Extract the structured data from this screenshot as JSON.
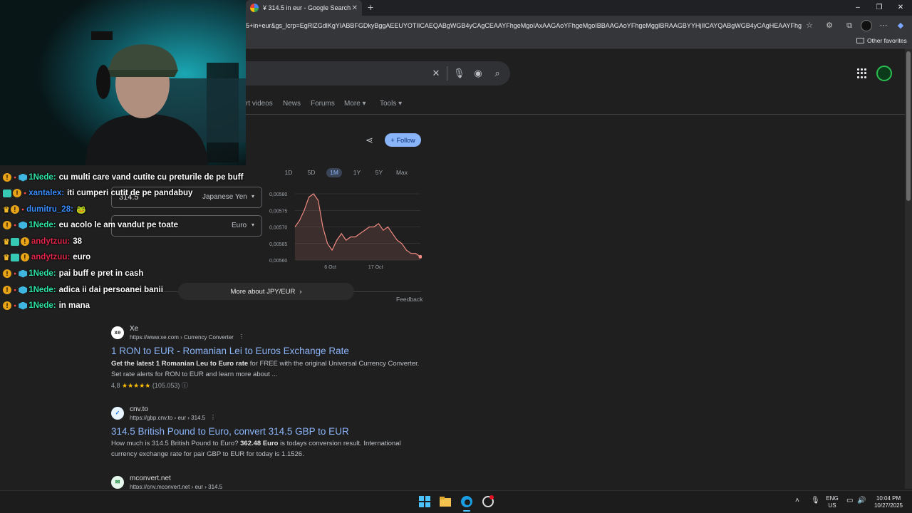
{
  "browser": {
    "tab_title": "¥ 314.5 in eur - Google Search",
    "new_tab": "+",
    "url": "5+in+eur&gs_lcrp=EgRlZGdlKgYIABBFGDkyBggAEEUYOTIICAEQABgWGB4yCAgCEAAYFhgeMgoIAxAAGAoYFhgeMgoIBBAAGAoYFhgeMggIBRAAGBYYHjIICAYQABgWGB4yCAgHEAAYFhge...",
    "other_favorites": "Other favorites",
    "window_controls": {
      "minimize": "–",
      "maximize": "❐",
      "close": "✕"
    }
  },
  "search": {
    "nav_tabs": [
      "rt videos",
      "News",
      "Forums",
      "More ▾",
      "Tools ▾"
    ],
    "follow_label": "Follow"
  },
  "finance": {
    "ranges": [
      "1D",
      "5D",
      "1M",
      "1Y",
      "5Y",
      "Max"
    ],
    "active_range": "1M",
    "converter": {
      "from_value": "314.5",
      "from_currency": "Japanese Yen",
      "to_value": "",
      "to_currency": "Euro"
    },
    "more_about": "More about JPY/EUR",
    "feedback": "Feedback"
  },
  "chart_data": {
    "type": "line",
    "title": "",
    "xlabel": "",
    "ylabel": "",
    "x_ticks": [
      "6 Oct",
      "17 Oct"
    ],
    "y_ticks": [
      "0,00580",
      "0,00575",
      "0,00570",
      "0,00565",
      "0,00560"
    ],
    "ylim": [
      0.0056,
      0.0058
    ],
    "grid": true,
    "series": [
      {
        "color": "#f28b82",
        "x": [
          0,
          1,
          2,
          3,
          4,
          5,
          6,
          7,
          8,
          9,
          10,
          11,
          12,
          13,
          14,
          15,
          16,
          17,
          18,
          19,
          20,
          21,
          22,
          23,
          24,
          25,
          26,
          27
        ],
        "values": [
          0.0057,
          0.00572,
          0.00575,
          0.00579,
          0.0058,
          0.00578,
          0.0057,
          0.00565,
          0.00563,
          0.00566,
          0.00568,
          0.00566,
          0.00567,
          0.00567,
          0.00568,
          0.00569,
          0.0057,
          0.0057,
          0.00571,
          0.00569,
          0.0057,
          0.00568,
          0.00566,
          0.00565,
          0.00563,
          0.00562,
          0.00562,
          0.00561
        ]
      }
    ]
  },
  "results": [
    {
      "site": "Xe",
      "favicon": "xe",
      "cite": "https://www.xe.com › Currency Converter",
      "title": "1 RON to EUR - Romanian Lei to Euros Exchange Rate",
      "snippet_bold": "Get the latest 1 Romanian Leu to Euro rate",
      "snippet_rest": " for FREE with the original Universal Currency Converter. Set rate alerts for RON to EUR and learn more about ...",
      "rating": "4,8",
      "stars": "★★★★★",
      "reviews": "(105.053)"
    },
    {
      "site": "cnv.to",
      "favicon": "✓",
      "cite": "https://gbp.cnv.to › eur › 314.5",
      "title": "314.5 British Pound to Euro, convert 314.5 GBP to EUR",
      "snippet_pre": "How much is 314.5 British Pound to Euro? ",
      "snippet_bold": "362.48 Euro",
      "snippet_post": " is todays conversion result. International currency exchange rate for pair GBP to EUR for today is 1.1526."
    },
    {
      "site": "mconvert.net",
      "favicon": "✉",
      "cite": "https://cny.mconvert.net › eur › 314.5"
    }
  ],
  "chat": [
    {
      "user": "1Nede:",
      "color": "#2ee6a6",
      "msg": "cu multi care vand cutite cu preturile de pe buff",
      "badges": "sub-cube"
    },
    {
      "user": "xantalex:",
      "color": "#3a8dff",
      "msg": "iti cumperi cutit de pe pandabuy",
      "badges": "vip"
    },
    {
      "user": "dumitru_28:",
      "color": "#3a8dff",
      "msg": "",
      "badges": "crown"
    },
    {
      "user": "1Nede:",
      "color": "#2ee6a6",
      "msg": "eu acolo le am vandut pe toate",
      "badges": "sub-cube"
    },
    {
      "user": "andytzuu:",
      "color": "#e0264a",
      "msg": "38",
      "badges": "crown-vip"
    },
    {
      "user": "andytzuu:",
      "color": "#e0264a",
      "msg": "euro",
      "badges": "crown-vip"
    },
    {
      "user": "1Nede:",
      "color": "#2ee6a6",
      "msg": "pai buff e pret in cash",
      "badges": "sub-cube"
    },
    {
      "user": "1Nede:",
      "color": "#2ee6a6",
      "msg": "adica ii dai persoanei banii",
      "badges": "sub-cube"
    },
    {
      "user": "1Nede:",
      "color": "#2ee6a6",
      "msg": "in mana",
      "badges": "sub-cube"
    }
  ],
  "taskbar": {
    "lang_top": "ENG",
    "lang_bottom": "US",
    "time": "10:04 PM",
    "date": "10/27/2025"
  }
}
